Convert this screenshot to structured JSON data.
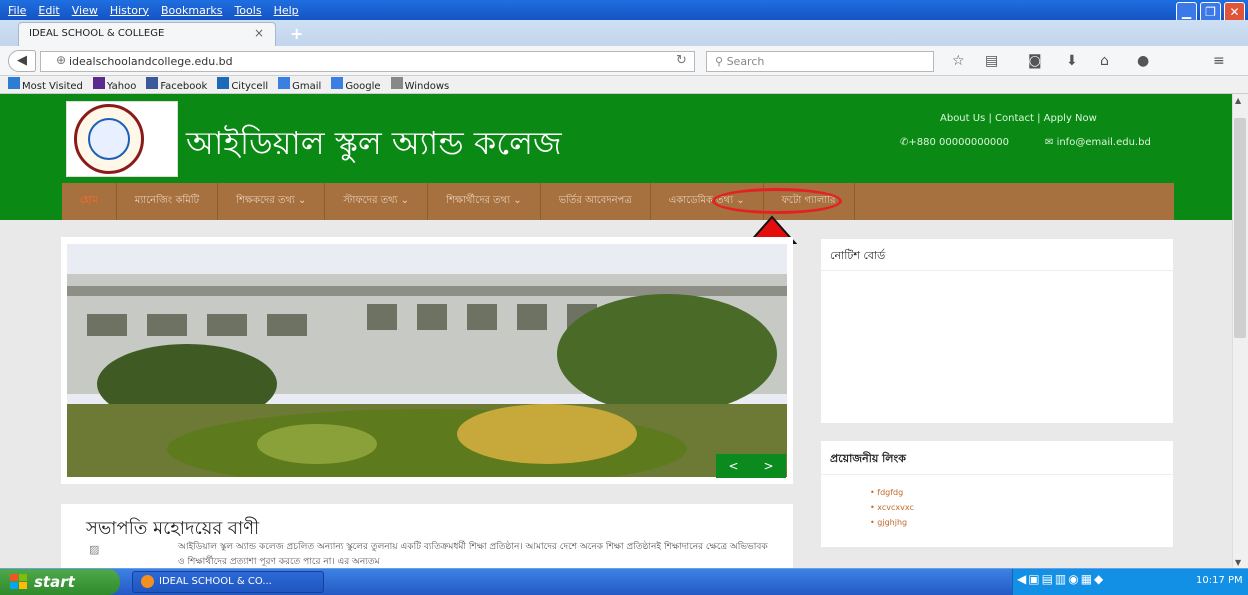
{
  "browser": {
    "menu": [
      "File",
      "Edit",
      "View",
      "History",
      "Bookmarks",
      "Tools",
      "Help"
    ],
    "tab_title": "IDEAL SCHOOL & COLLEGE",
    "url": "idealschoolandcollege.edu.bd",
    "search_placeholder": "Search",
    "bookmarks": [
      {
        "label": "Most Visited",
        "icon": "most-visited-icon",
        "color": "#2d7dd2"
      },
      {
        "label": "Yahoo",
        "icon": "yahoo-icon",
        "color": "#5a2a8f"
      },
      {
        "label": "Facebook",
        "icon": "facebook-icon",
        "color": "#3b5998"
      },
      {
        "label": "Citycell",
        "icon": "citycell-icon",
        "color": "#1c6ab8"
      },
      {
        "label": "Gmail",
        "icon": "google-icon",
        "color": "#3b7fe0"
      },
      {
        "label": "Google",
        "icon": "google-icon",
        "color": "#3b7fe0"
      },
      {
        "label": "Windows",
        "icon": "folder-icon",
        "color": "#888888"
      }
    ]
  },
  "site": {
    "name": "আইডিয়াল স্কুল অ্যান্ড কলেজ",
    "top_links": "About Us  |  Contact  |  Apply Now",
    "phone": "+880 00000000000",
    "email": "info@email.edu.bd",
    "nav": [
      {
        "label": "হোম",
        "active": true
      },
      {
        "label": "ম্যানেজিং কমিটি",
        "active": false
      },
      {
        "label": "শিক্ষকদের তথ্য  ⌄",
        "active": false
      },
      {
        "label": "স্টাফদের তথ্য  ⌄",
        "active": false
      },
      {
        "label": "শিক্ষার্থীদের তথ্য  ⌄",
        "active": false
      },
      {
        "label": "ভর্তির আবেদনপত্র",
        "active": false
      },
      {
        "label": "একাডেমিক তথ্য  ⌄",
        "active": false
      },
      {
        "label": "ফটো গ্যালারি",
        "active": false
      }
    ],
    "slider_prev": "<",
    "slider_next": ">",
    "notice_title": "নোটিশ বোর্ড",
    "links_title": "প্রয়োজনীয় লিংক",
    "links": [
      "fdgfdg",
      "xcvcxvxc",
      "gjghjhg"
    ],
    "article_title": "সভাপতি মহোদয়ের বাণী",
    "article_text": "আইডিয়াল স্কুল অ্যান্ড কলেজ প্রচলিত অন্যান্য স্কুলের তুলনায় একটি ব্যতিক্রমধর্মী শিক্ষা প্রতিষ্ঠান। আমাদের দেশে অনেক শিক্ষা প্রতিষ্ঠানই শিক্ষাদানের ক্ষেত্রে অভিভাবক ও শিক্ষার্থীদের প্রত্যাশা পূরণ করতে পারে না। এর অন্যতম"
  },
  "taskbar": {
    "start": "start",
    "window_label": "IDEAL SCHOOL & CO...",
    "clock": "10:17 PM"
  },
  "colors": {
    "header_green": "#0a8a14",
    "nav_brown": "#a7703f",
    "highlight_red": "#e52020"
  }
}
